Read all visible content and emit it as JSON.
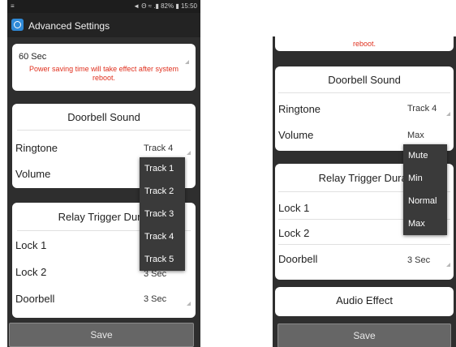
{
  "left": {
    "status_bar": {
      "left_icons": "≡",
      "right_text": "◄ Θ ≈ .▮ 82% ▮ 15:50"
    },
    "app_title": "Advanced Settings",
    "power_card": {
      "value": "60 Sec",
      "note": "Power saving time will take effect after system reboot."
    },
    "doorbell_card": {
      "title": "Doorbell Sound",
      "ringtone_label": "Ringtone",
      "ringtone_value": "Track 4",
      "volume_label": "Volume"
    },
    "ringtone_menu": [
      "Track 1",
      "Track 2",
      "Track 3",
      "Track 4",
      "Track 5"
    ],
    "relay_card": {
      "title": "Relay Trigger Durat",
      "rows": [
        {
          "label": "Lock 1",
          "value": ""
        },
        {
          "label": "Lock 2",
          "value": "3 Sec"
        },
        {
          "label": "Doorbell",
          "value": "3 Sec"
        }
      ]
    },
    "save_label": "Save"
  },
  "right": {
    "top_text": "reboot.",
    "doorbell_card": {
      "title": "Doorbell Sound",
      "ringtone_label": "Ringtone",
      "ringtone_value": "Track 4",
      "volume_label": "Volume",
      "volume_value": "Max"
    },
    "volume_menu": [
      "Mute",
      "Min",
      "Normal",
      "Max"
    ],
    "relay_card": {
      "title": "Relay Trigger Durat",
      "rows": [
        {
          "label": "Lock 1",
          "value": ""
        },
        {
          "label": "Lock 2",
          "value": ""
        },
        {
          "label": "Doorbell",
          "value": "3 Sec"
        }
      ]
    },
    "audio_card": {
      "title": "Audio Effect"
    },
    "save_label": "Save"
  },
  "colors": {
    "note_red": "#e0301e",
    "menu_bg": "#3a3a3a",
    "app_icon": "#2f8ad8"
  }
}
